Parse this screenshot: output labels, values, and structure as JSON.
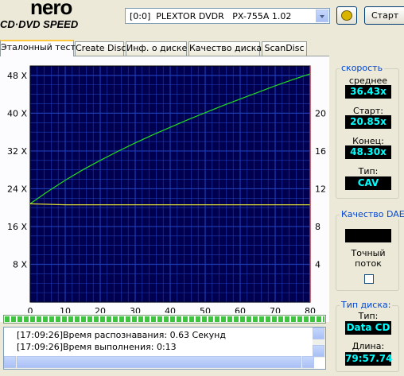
{
  "logo": {
    "brand": "nero",
    "product": "CD·DVD SPEED"
  },
  "toolbar": {
    "drive": "[0:0]  PLEXTOR DVDR   PX-755A 1.02",
    "start_label": "Старт"
  },
  "tabs": [
    {
      "label": "Эталонный тест",
      "active": true
    },
    {
      "label": "Create Disc",
      "active": false
    },
    {
      "label": "Инф. о диске",
      "active": false
    },
    {
      "label": "Качество диска",
      "active": false
    },
    {
      "label": "ScanDisc",
      "active": false
    }
  ],
  "chart_data": {
    "type": "line",
    "x_ticks": [
      "0",
      "10",
      "20",
      "30",
      "40",
      "50",
      "60",
      "70",
      "80"
    ],
    "y_left_ticks": [
      "8 X",
      "16 X",
      "24 X",
      "32 X",
      "40 X",
      "48 X"
    ],
    "y_right_ticks": [
      "4",
      "8",
      "12",
      "16",
      "20"
    ],
    "xlim": [
      0,
      80
    ],
    "ylim_left": [
      0,
      50
    ],
    "ylim_right": [
      0,
      25
    ],
    "grid": true,
    "colors": {
      "background": "#000050",
      "grid": "#1e3cb4",
      "speed": "#22dd22",
      "cpu": "#dddd33",
      "marker": "#c02020"
    },
    "end_marker_x": 79.96,
    "series": [
      {
        "axis": "left",
        "x": [
          0,
          5,
          10,
          15,
          20,
          25,
          30,
          35,
          40,
          45,
          50,
          55,
          60,
          65,
          70,
          75,
          79.9
        ],
        "y": [
          20.85,
          23.4,
          25.8,
          28.0,
          30.0,
          31.9,
          33.7,
          35.4,
          37.0,
          38.6,
          40.1,
          41.6,
          43.0,
          44.4,
          45.8,
          47.1,
          48.3
        ]
      },
      {
        "axis": "left",
        "x": [
          0,
          10,
          20,
          30,
          40,
          50,
          60,
          70,
          79.9
        ],
        "y": [
          20.8,
          20.6,
          20.6,
          20.6,
          20.6,
          20.6,
          20.6,
          20.6,
          20.6
        ]
      }
    ]
  },
  "progress": {
    "percent": 100
  },
  "log": [
    {
      "time": "[17:09:26]",
      "text": "Время распознавания: 0.63 Секунд"
    },
    {
      "time": "[17:09:26]",
      "text": "Время выполнения: 0:13"
    }
  ],
  "speed_group": {
    "title": "скорость",
    "average_label": "среднее",
    "average": "36.43x",
    "start_label": "Старт:",
    "start": "20.85x",
    "end_label": "Конец:",
    "end": "48.30x",
    "type_label": "Тип:",
    "type": "CAV"
  },
  "dae_group": {
    "title": "Качество DAE",
    "value": "",
    "accurate_label": "Точный поток",
    "accurate_checked": false
  },
  "disc_group": {
    "title": "Тип диска:",
    "type_label": "Тип:",
    "type": "Data CD",
    "length_label": "Длина:",
    "length": "79:57.74"
  }
}
